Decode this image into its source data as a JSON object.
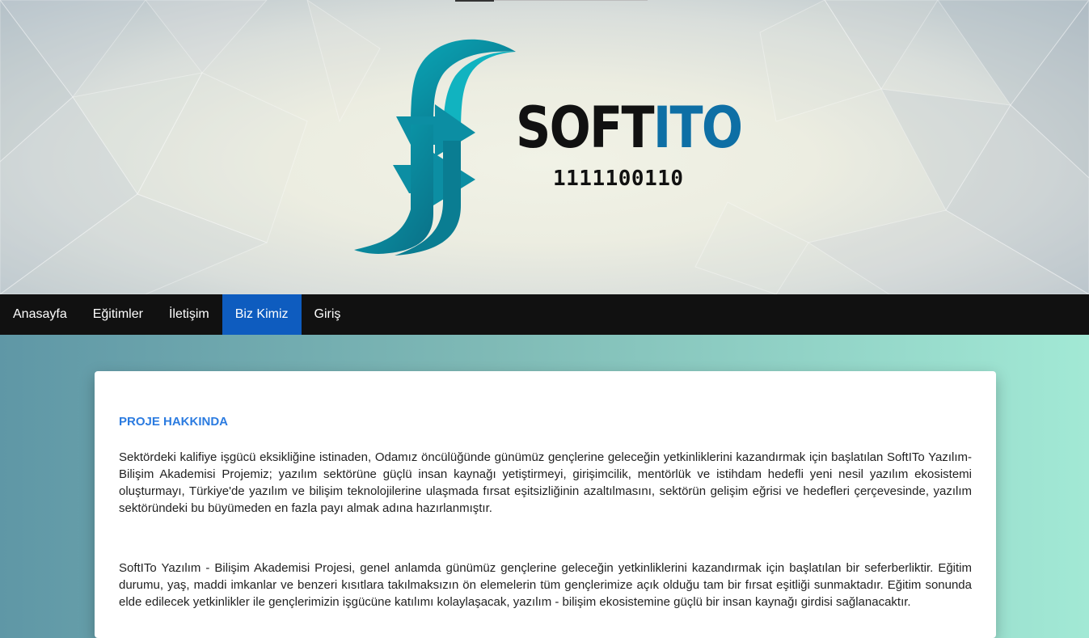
{
  "header": {
    "logo": {
      "brand_part1": "SOFT",
      "brand_part2": "ITO",
      "binary": "1111100110",
      "icon": "softito-f-logo-icon"
    }
  },
  "nav": {
    "items": [
      {
        "label": "Anasayfa"
      },
      {
        "label": "Eğitimler"
      },
      {
        "label": "İletişim"
      },
      {
        "label": "Biz Kimiz",
        "active": true
      },
      {
        "label": "Giriş"
      }
    ]
  },
  "main": {
    "heading": "PROJE HAKKINDA",
    "paragraph1": "Sektördeki kalifiye işgücü eksikliğine istinaden, Odamız öncülüğünde günümüz gençlerine geleceğin yetkinliklerini kazandırmak için başlatılan SoftITo Yazılım-Bilişim Akademisi Projemiz; yazılım sektörüne güçlü insan kaynağı yetiştirmeyi, girişimcilik, mentörlük ve istihdam hedefli yeni nesil yazılım ekosistemi oluşturmayı, Türkiye'de yazılım ve bilişim teknolojilerine ulaşmada fırsat eşitsizliğinin azaltılmasını, sektörün gelişim eğrisi ve hedefleri çerçevesinde, yazılım sektöründeki bu büyümeden en fazla payı almak adına hazırlanmıştır.",
    "paragraph2": "SoftITo Yazılım - Bilişim Akademisi Projesi, genel anlamda günümüz gençlerine geleceğin yetkinliklerini kazandırmak için başlatılan bir seferberliktir. Eğitim durumu, yaş, maddi imkanlar ve benzeri kısıtlara takılmaksızın ön elemelerin tüm gençlerimize açık olduğu tam bir fırsat eşitliği sunmaktadır. Eğitim sonunda elde edilecek yetkinlikler ile gençlerimizin işgücüne katılımı kolaylaşacak, yazılım - bilişim ekosistemine güçlü bir insan kaynağı girdisi sağlanacaktır."
  },
  "colors": {
    "nav_bg": "#111111",
    "nav_active": "#0e5cbf",
    "heading": "#2b7be0",
    "brand_blue": "#0e6fa5",
    "logo_teal": "#0fa3b1"
  }
}
